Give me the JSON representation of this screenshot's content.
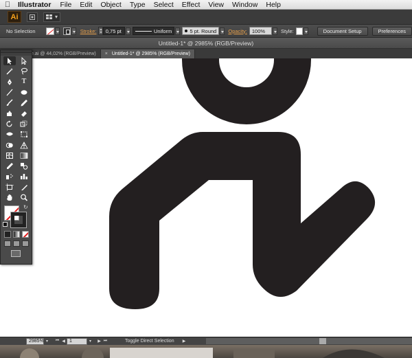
{
  "menubar": {
    "app_name": "Illustrator",
    "menus": [
      "File",
      "Edit",
      "Object",
      "Type",
      "Select",
      "Effect",
      "View",
      "Window",
      "Help"
    ]
  },
  "appbar": {
    "logo": "Ai"
  },
  "controlbar": {
    "selection": "No Selection",
    "stroke_label": "Stroke:",
    "stroke_weight": "0,75 pt",
    "profile": "Uniform",
    "brush": "5 pt. Round",
    "opacity_label": "Opacity:",
    "opacity": "100%",
    "style_label": "Style:",
    "document_setup": "Document Setup",
    "preferences": "Preferences",
    "colors": {
      "orange_label": "#e7a04b"
    }
  },
  "document": {
    "title": "Untitled-1* @ 2985% (RGB/Preview)",
    "tabs": [
      {
        "label": "e.ai @ 44,02% (RGB/Preview)",
        "active": false
      },
      {
        "label": "Untitled-1* @ 2985% (RGB/Preview)",
        "active": true
      }
    ]
  },
  "artwork": {
    "description_color": "#231f20",
    "shape_color": "#231f20"
  },
  "status": {
    "zoom": "2985%",
    "artboard": "1",
    "tool_name": "Toggle Direct Selection"
  }
}
